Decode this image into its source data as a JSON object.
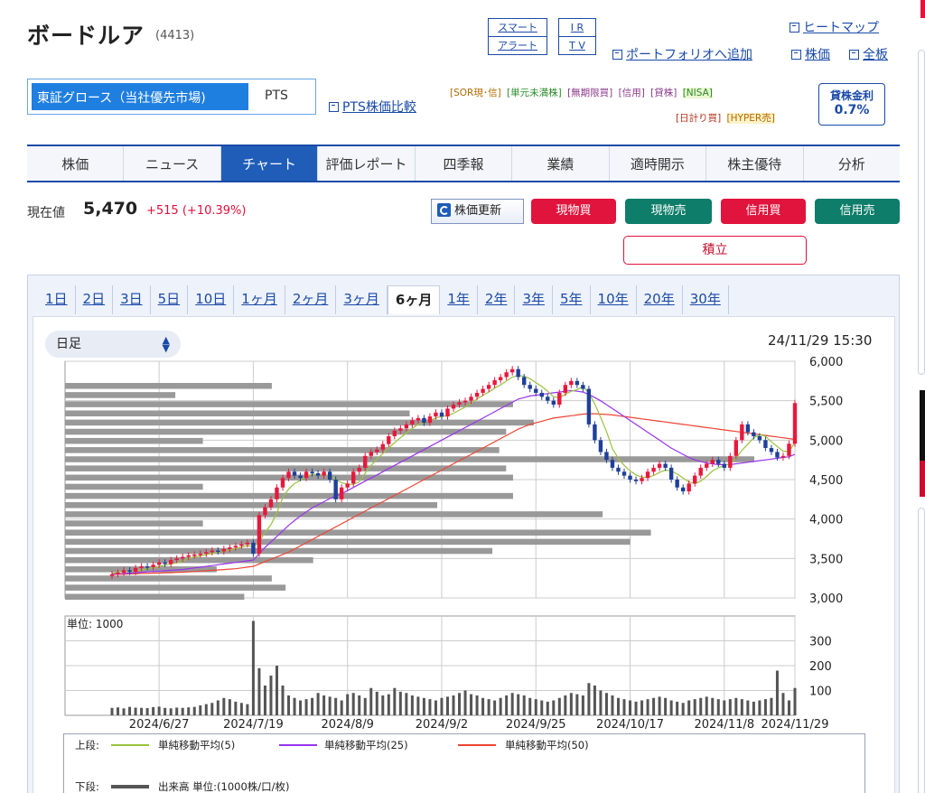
{
  "header": {
    "title": "ボードルア",
    "code": "(4413)",
    "smart_alert_l1": "スマート",
    "smart_alert_l2": "アラート",
    "irtv_l1": "I R",
    "irtv_l2": "T V",
    "heatmap": "ヒートマップ",
    "portfolio": "ポートフォリオへ追加",
    "kabuka": "株価",
    "zenita": "全板"
  },
  "market": {
    "selected": "東証グロース（当社優先市場)",
    "pts": "PTS",
    "pts_compare": "PTS株価比較"
  },
  "tags": {
    "row1": [
      "[SOR現･信]",
      "[単元未満株]",
      "[無期限買]",
      "[信用]",
      "[貸株]",
      "[NISA]"
    ],
    "row2": [
      "[日計り買]",
      "[HYPER売]"
    ]
  },
  "lending_rate": {
    "label": "貸株金利",
    "value": "0.7%"
  },
  "tabs": [
    "株価",
    "ニュース",
    "チャート",
    "評価レポート",
    "四季報",
    "業績",
    "適時開示",
    "株主優待",
    "分析"
  ],
  "active_tab": "チャート",
  "price": {
    "label": "現在値",
    "value": "5,470",
    "change": "+515",
    "change_pct": "(+10.39%)"
  },
  "actions": {
    "update": "株価更新",
    "cash_buy": "現物買",
    "cash_sell": "現物売",
    "margin_buy": "信用買",
    "margin_sell": "信用売",
    "accumulate": "積立"
  },
  "periods": [
    "1日",
    "2日",
    "3日",
    "5日",
    "10日",
    "1ヶ月",
    "2ヶ月",
    "3ヶ月",
    "6ヶ月",
    "1年",
    "2年",
    "3年",
    "5年",
    "10年",
    "20年",
    "30年"
  ],
  "active_period": "6ヶ月",
  "chart": {
    "interval": "日足",
    "datetime": "24/11/29 15:30",
    "volume_unit": "単位: 1000",
    "legend_upper": "上段:",
    "legend_lower": "下段:",
    "sma5": "単純移動平均(5)",
    "sma25": "単純移動平均(25)",
    "sma50": "単純移動平均(50)",
    "volume_legend": "出来高 単位:(1000株/口/枚)"
  },
  "chart_data": {
    "type": "candlestick",
    "x_labels": [
      "2024/6/27",
      "2024/7/19",
      "2024/8/9",
      "2024/9/2",
      "2024/9/25",
      "2024/10/17",
      "2024/11/8",
      "2024/11/29"
    ],
    "price_axis": {
      "ylim": [
        3000,
        6000
      ],
      "ticks": [
        "6,000",
        "5,500",
        "5,000",
        "4,500",
        "4,000",
        "3,500",
        "3,000"
      ]
    },
    "volume_axis": {
      "ticks": [
        "300",
        "200",
        "100"
      ]
    },
    "close": [
      3300,
      3320,
      3350,
      3330,
      3380,
      3400,
      3390,
      3420,
      3450,
      3430,
      3480,
      3500,
      3520,
      3540,
      3550,
      3560,
      3580,
      3600,
      3590,
      3620,
      3640,
      3660,
      3680,
      3700,
      3560,
      4050,
      4150,
      4250,
      4400,
      4520,
      4600,
      4550,
      4520,
      4600,
      4580,
      4550,
      4600,
      4500,
      4250,
      4400,
      4450,
      4600,
      4650,
      4800,
      4850,
      4880,
      4950,
      5050,
      5120,
      5150,
      5200,
      5250,
      5280,
      5220,
      5300,
      5350,
      5300,
      5400,
      5450,
      5480,
      5500,
      5550,
      5600,
      5650,
      5700,
      5760,
      5800,
      5860,
      5900,
      5800,
      5700,
      5650,
      5600,
      5550,
      5500,
      5450,
      5600,
      5700,
      5750,
      5700,
      5650,
      5200,
      5000,
      4850,
      4750,
      4650,
      4600,
      4550,
      4500,
      4480,
      4520,
      4600,
      4650,
      4700,
      4650,
      4500,
      4400,
      4350,
      4450,
      4550,
      4650,
      4700,
      4750,
      4700,
      4650,
      4800,
      5000,
      5200,
      5100,
      5050,
      5000,
      4900,
      4850,
      4780,
      4800,
      4955,
      5470
    ],
    "sma5": [
      3310,
      3325,
      3340,
      3340,
      3345,
      3355,
      3370,
      3385,
      3400,
      3415,
      3430,
      3445,
      3470,
      3500,
      3520,
      3535,
      3550,
      3565,
      3580,
      3590,
      3610,
      3625,
      3645,
      3665,
      3645,
      3720,
      3830,
      3930,
      4080,
      4270,
      4380,
      4450,
      4490,
      4540,
      4570,
      4560,
      4560,
      4550,
      4500,
      4460,
      4440,
      4440,
      4470,
      4580,
      4680,
      4760,
      4830,
      4900,
      4970,
      5030,
      5090,
      5150,
      5200,
      5220,
      5250,
      5280,
      5300,
      5310,
      5340,
      5380,
      5420,
      5470,
      5520,
      5570,
      5610,
      5660,
      5700,
      5750,
      5800,
      5820,
      5810,
      5780,
      5730,
      5680,
      5620,
      5550,
      5540,
      5580,
      5620,
      5640,
      5680,
      5600,
      5460,
      5290,
      5110,
      4890,
      4770,
      4680,
      4610,
      4560,
      4530,
      4530,
      4550,
      4590,
      4620,
      4610,
      4570,
      4520,
      4470,
      4450,
      4480,
      4540,
      4610,
      4650,
      4680,
      4700,
      4770,
      4870,
      4950,
      5030,
      5070,
      5050,
      4980,
      4920,
      4860,
      4860,
      4970
    ],
    "sma25": [
      3300,
      3305,
      3310,
      3315,
      3320,
      3325,
      3330,
      3335,
      3340,
      3345,
      3350,
      3355,
      3360,
      3370,
      3380,
      3390,
      3400,
      3410,
      3420,
      3430,
      3440,
      3450,
      3460,
      3470,
      3480,
      3560,
      3640,
      3710,
      3780,
      3850,
      3920,
      3980,
      4040,
      4090,
      4140,
      4180,
      4220,
      4260,
      4290,
      4320,
      4360,
      4400,
      4440,
      4480,
      4520,
      4560,
      4600,
      4640,
      4680,
      4720,
      4760,
      4800,
      4840,
      4880,
      4920,
      4960,
      5000,
      5040,
      5080,
      5120,
      5160,
      5200,
      5240,
      5280,
      5320,
      5360,
      5400,
      5440,
      5480,
      5520,
      5540,
      5560,
      5570,
      5580,
      5590,
      5600,
      5610,
      5620,
      5630,
      5620,
      5610,
      5580,
      5540,
      5500,
      5450,
      5400,
      5350,
      5300,
      5250,
      5200,
      5150,
      5100,
      5050,
      5000,
      4950,
      4900,
      4860,
      4820,
      4780,
      4750,
      4730,
      4710,
      4700,
      4690,
      4690,
      4690,
      4700,
      4710,
      4720,
      4730,
      4740,
      4750,
      4760,
      4770,
      4780,
      4790,
      4820
    ],
    "sma50": [
      3300,
      3300,
      3300,
      3305,
      3305,
      3310,
      3310,
      3315,
      3315,
      3320,
      3320,
      3325,
      3325,
      3330,
      3335,
      3340,
      3345,
      3350,
      3355,
      3360,
      3365,
      3370,
      3380,
      3390,
      3400,
      3430,
      3460,
      3490,
      3520,
      3550,
      3580,
      3620,
      3660,
      3700,
      3740,
      3780,
      3820,
      3860,
      3900,
      3940,
      3980,
      4020,
      4060,
      4100,
      4140,
      4180,
      4220,
      4260,
      4300,
      4340,
      4380,
      4420,
      4460,
      4500,
      4540,
      4580,
      4620,
      4660,
      4700,
      4740,
      4780,
      4820,
      4860,
      4900,
      4940,
      4980,
      5020,
      5060,
      5100,
      5140,
      5170,
      5200,
      5220,
      5240,
      5260,
      5280,
      5290,
      5300,
      5310,
      5320,
      5330,
      5335,
      5335,
      5330,
      5325,
      5320,
      5310,
      5300,
      5290,
      5280,
      5270,
      5260,
      5250,
      5240,
      5230,
      5220,
      5210,
      5200,
      5190,
      5180,
      5170,
      5160,
      5150,
      5140,
      5130,
      5120,
      5110,
      5100,
      5090,
      5080,
      5070,
      5060,
      5050,
      5040,
      5030,
      5020,
      5010
    ],
    "volume": [
      30,
      32,
      28,
      34,
      31,
      30,
      29,
      33,
      35,
      30,
      28,
      31,
      30,
      32,
      34,
      40,
      45,
      50,
      60,
      70,
      65,
      55,
      50,
      45,
      380,
      190,
      120,
      160,
      200,
      120,
      80,
      70,
      60,
      65,
      70,
      90,
      80,
      75,
      70,
      60,
      85,
      90,
      80,
      70,
      110,
      95,
      80,
      85,
      110,
      95,
      90,
      80,
      75,
      70,
      65,
      60,
      70,
      75,
      80,
      90,
      100,
      85,
      80,
      70,
      65,
      60,
      70,
      80,
      90,
      85,
      80,
      70,
      65,
      60,
      55,
      60,
      70,
      80,
      90,
      85,
      80,
      130,
      120,
      100,
      90,
      80,
      70,
      65,
      60,
      55,
      60,
      65,
      70,
      75,
      70,
      60,
      55,
      50,
      60,
      65,
      70,
      75,
      70,
      65,
      60,
      65,
      70,
      65,
      60,
      55,
      60,
      65,
      70,
      180,
      90,
      60,
      110
    ],
    "volume_profile": [
      0.3,
      0.16,
      0.65,
      0.5,
      0.68,
      0.64,
      0.2,
      0.63,
      1.0,
      0.64,
      0.65,
      0.2,
      0.65,
      0.54,
      0.78,
      0.2,
      0.85,
      0.82,
      0.62,
      0.36,
      0.22,
      0.3,
      0.32,
      0.26
    ]
  }
}
